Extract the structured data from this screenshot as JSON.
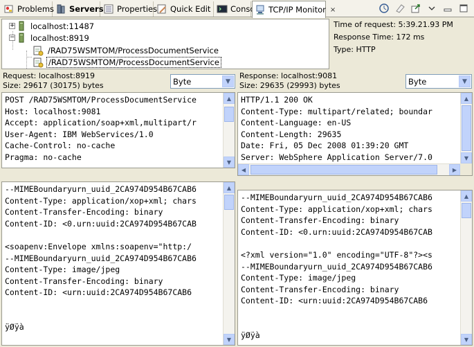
{
  "tabs": [
    {
      "label": "Problems",
      "icon": "problems-icon"
    },
    {
      "label": "Servers",
      "icon": "servers-icon"
    },
    {
      "label": "Properties",
      "icon": "properties-icon"
    },
    {
      "label": "Quick Edit",
      "icon": "quick-edit-icon"
    },
    {
      "label": "Console",
      "icon": "console-icon"
    },
    {
      "label": "TCP/IP Monitor",
      "icon": "tcpip-monitor-icon",
      "close": "×"
    }
  ],
  "tree": {
    "nodes": [
      {
        "label": "localhost:11487"
      },
      {
        "label": "localhost:8919"
      },
      {
        "label": "/RAD75WSMTOM/ProcessDocumentService"
      },
      {
        "label": "/RAD75WSMTOM/ProcessDocumentService"
      }
    ]
  },
  "info": {
    "time_of_request": "Time of request: 5:39.21.93 PM",
    "response_time": "Response Time: 172 ms",
    "type": "Type: HTTP"
  },
  "request": {
    "title": "Request: localhost:8919",
    "size": "Size: 29617 (30175) bytes",
    "format": "Byte",
    "header_text": "POST /RAD75WSMTOM/ProcessDocumentService\nHost: localhost:9081\nAccept: application/soap+xml,multipart/r\nUser-Agent: IBM WebServices/1.0\nCache-Control: no-cache\nPragma: no-cache",
    "body_text": "--MIMEBoundaryurn_uuid_2CA974D954B67CAB6\nContent-Type: application/xop+xml; chars\nContent-Transfer-Encoding: binary\nContent-ID: <0.urn:uuid:2CA974D954B67CAB\n\n<soapenv:Envelope xmlns:soapenv=\"http:/\n--MIMEBoundaryurn_uuid_2CA974D954B67CAB6\nContent-Type: image/jpeg\nContent-Transfer-Encoding: binary\nContent-ID: <urn:uuid:2CA974D954B67CAB6\n\n\nÿØÿà"
  },
  "response": {
    "title": "Response: localhost:9081",
    "size": "Size: 29635 (29993) bytes",
    "format": "Byte",
    "header_text": "HTTP/1.1 200 OK\nContent-Type: multipart/related; boundar\nContent-Language: en-US\nContent-Length: 29635\nDate: Fri, 05 Dec 2008 01:39:20 GMT\nServer: WebSphere Application Server/7.0",
    "body_text": "--MIMEBoundaryurn_uuid_2CA974D954B67CAB6\nContent-Type: application/xop+xml; chars\nContent-Transfer-Encoding: binary\nContent-ID: <0.urn:uuid:2CA974D954B67CAB\n\n<?xml version=\"1.0\" encoding=\"UTF-8\"?><s\n--MIMEBoundaryurn_uuid_2CA974D954B67CAB6\nContent-Type: image/jpeg\nContent-Transfer-Encoding: binary\nContent-ID: <urn:uuid:2CA974D954B67CAB6\n\n\nÿØÿà"
  },
  "toolbar": {
    "icons": [
      "properties-toolbar-icon",
      "clear-icon",
      "export-icon",
      "minimize-icon",
      "view-menu-icon"
    ]
  }
}
